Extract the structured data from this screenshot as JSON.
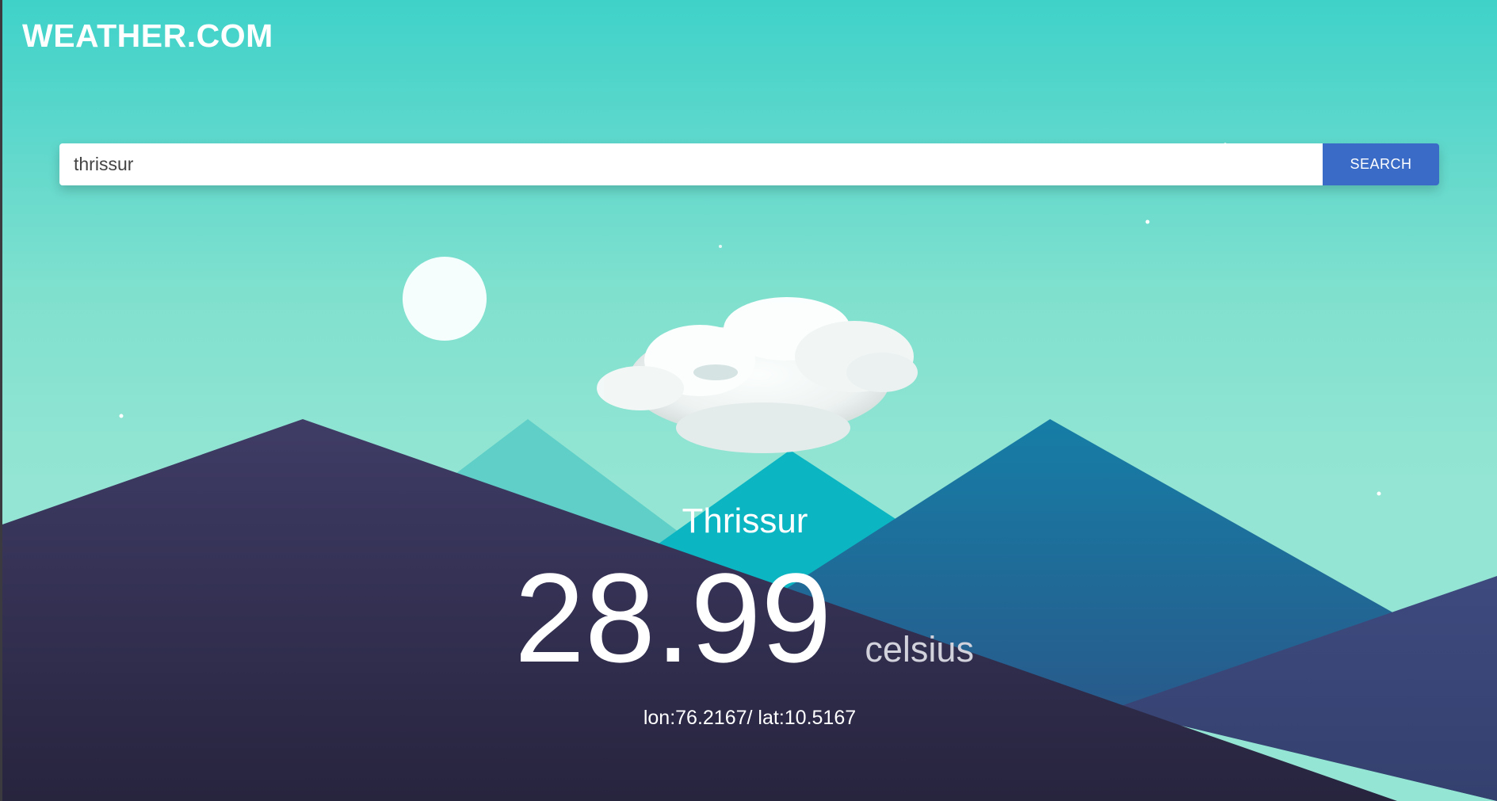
{
  "header": {
    "brand": "WEATHER.COM"
  },
  "search": {
    "value": "thrissur",
    "placeholder": "",
    "button_label": "SEARCH"
  },
  "weather": {
    "city": "Thrissur",
    "temperature": "28.99",
    "unit": "celsius",
    "coordinates": "lon:76.2167/ lat:10.5167"
  },
  "colors": {
    "sky_top": "#3fd2c9",
    "sky_bottom": "#94e5d3",
    "search_button": "#3a6cc7",
    "mountain_dark": "#2f2a4a",
    "mountain_blue": "#1f7aa3",
    "mountain_teal": "#0bb5c2"
  }
}
